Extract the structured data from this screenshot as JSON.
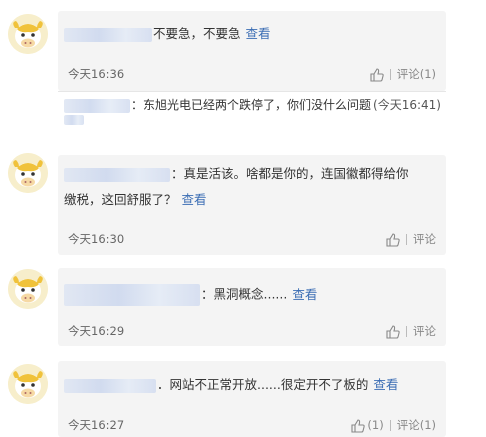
{
  "comments": [
    {
      "text": "不要急，不要急",
      "more": "查看",
      "time": "今天16:36",
      "like_count": "",
      "reply_label": "评论(1)",
      "reply": {
        "text": "：东旭光电已经两个跌停了，你们没什么问题",
        "time": "(今天16:41)"
      }
    },
    {
      "text_line1": "：真是活该。啥都是你的，连国徽都得给你",
      "text_line2": "缴税，这回舒服了？",
      "more": "查看",
      "time": "今天16:30",
      "reply_label": "评论"
    },
    {
      "text": "：黑洞概念......",
      "more": "查看",
      "time": "今天16:29",
      "reply_label": "评论"
    },
    {
      "text": "．网站不正常开放......很定开不了板的",
      "more": "查看",
      "time": "今天16:27",
      "like_count": "(1)",
      "reply_label": "评论(1)"
    }
  ],
  "icons": {
    "avatar": "cow-face-avatar",
    "like": "thumbs-up-icon"
  },
  "colors": {
    "card": "#f4f4f4",
    "link": "#3c6eb4",
    "meta": "#666666"
  }
}
